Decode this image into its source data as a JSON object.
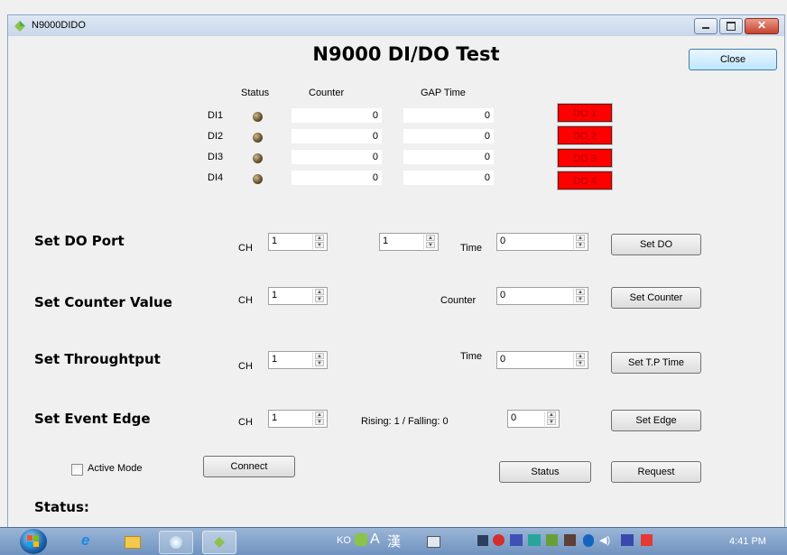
{
  "window": {
    "title": "N9000DIDO"
  },
  "header": {
    "title": "N9000 DI/DO Test",
    "close_label": "Close"
  },
  "di_table": {
    "columns": [
      "Status",
      "Counter",
      "GAP Time"
    ],
    "rows": [
      {
        "label": "DI1",
        "counter": "0",
        "gap": "0",
        "do": "DO 1"
      },
      {
        "label": "DI2",
        "counter": "0",
        "gap": "0",
        "do": "DO 2"
      },
      {
        "label": "DI3",
        "counter": "0",
        "gap": "0",
        "do": "DO 3"
      },
      {
        "label": "DI4",
        "counter": "0",
        "gap": "0",
        "do": "DO 4"
      }
    ],
    "do_color": "#ff0000"
  },
  "set_do": {
    "title": "Set DO Port",
    "ch_label": "CH",
    "ch_value": "1",
    "value": "1",
    "time_label": "Time",
    "time_value": "0",
    "button": "Set DO"
  },
  "set_counter": {
    "title": "Set Counter Value",
    "ch_label": "CH",
    "ch_value": "1",
    "counter_label": "Counter",
    "counter_value": "0",
    "button": "Set Counter"
  },
  "set_tp": {
    "title": "Set Throughtput",
    "ch_label": "CH",
    "ch_value": "1",
    "time_label": "Time",
    "time_value": "0",
    "button": "Set T.P Time"
  },
  "set_edge": {
    "title": "Set Event Edge",
    "ch_label": "CH",
    "ch_value": "1",
    "hint": "Rising: 1 / Falling: 0",
    "edge_value": "0",
    "button": "Set Edge"
  },
  "controls": {
    "active_mode_label": "Active Mode",
    "connect": "Connect",
    "status": "Status",
    "request": "Request"
  },
  "status_label": "Status:",
  "taskbar": {
    "ime": "KO",
    "ime_a": "A",
    "ime_han": "漢",
    "time": "4:41 PM"
  }
}
